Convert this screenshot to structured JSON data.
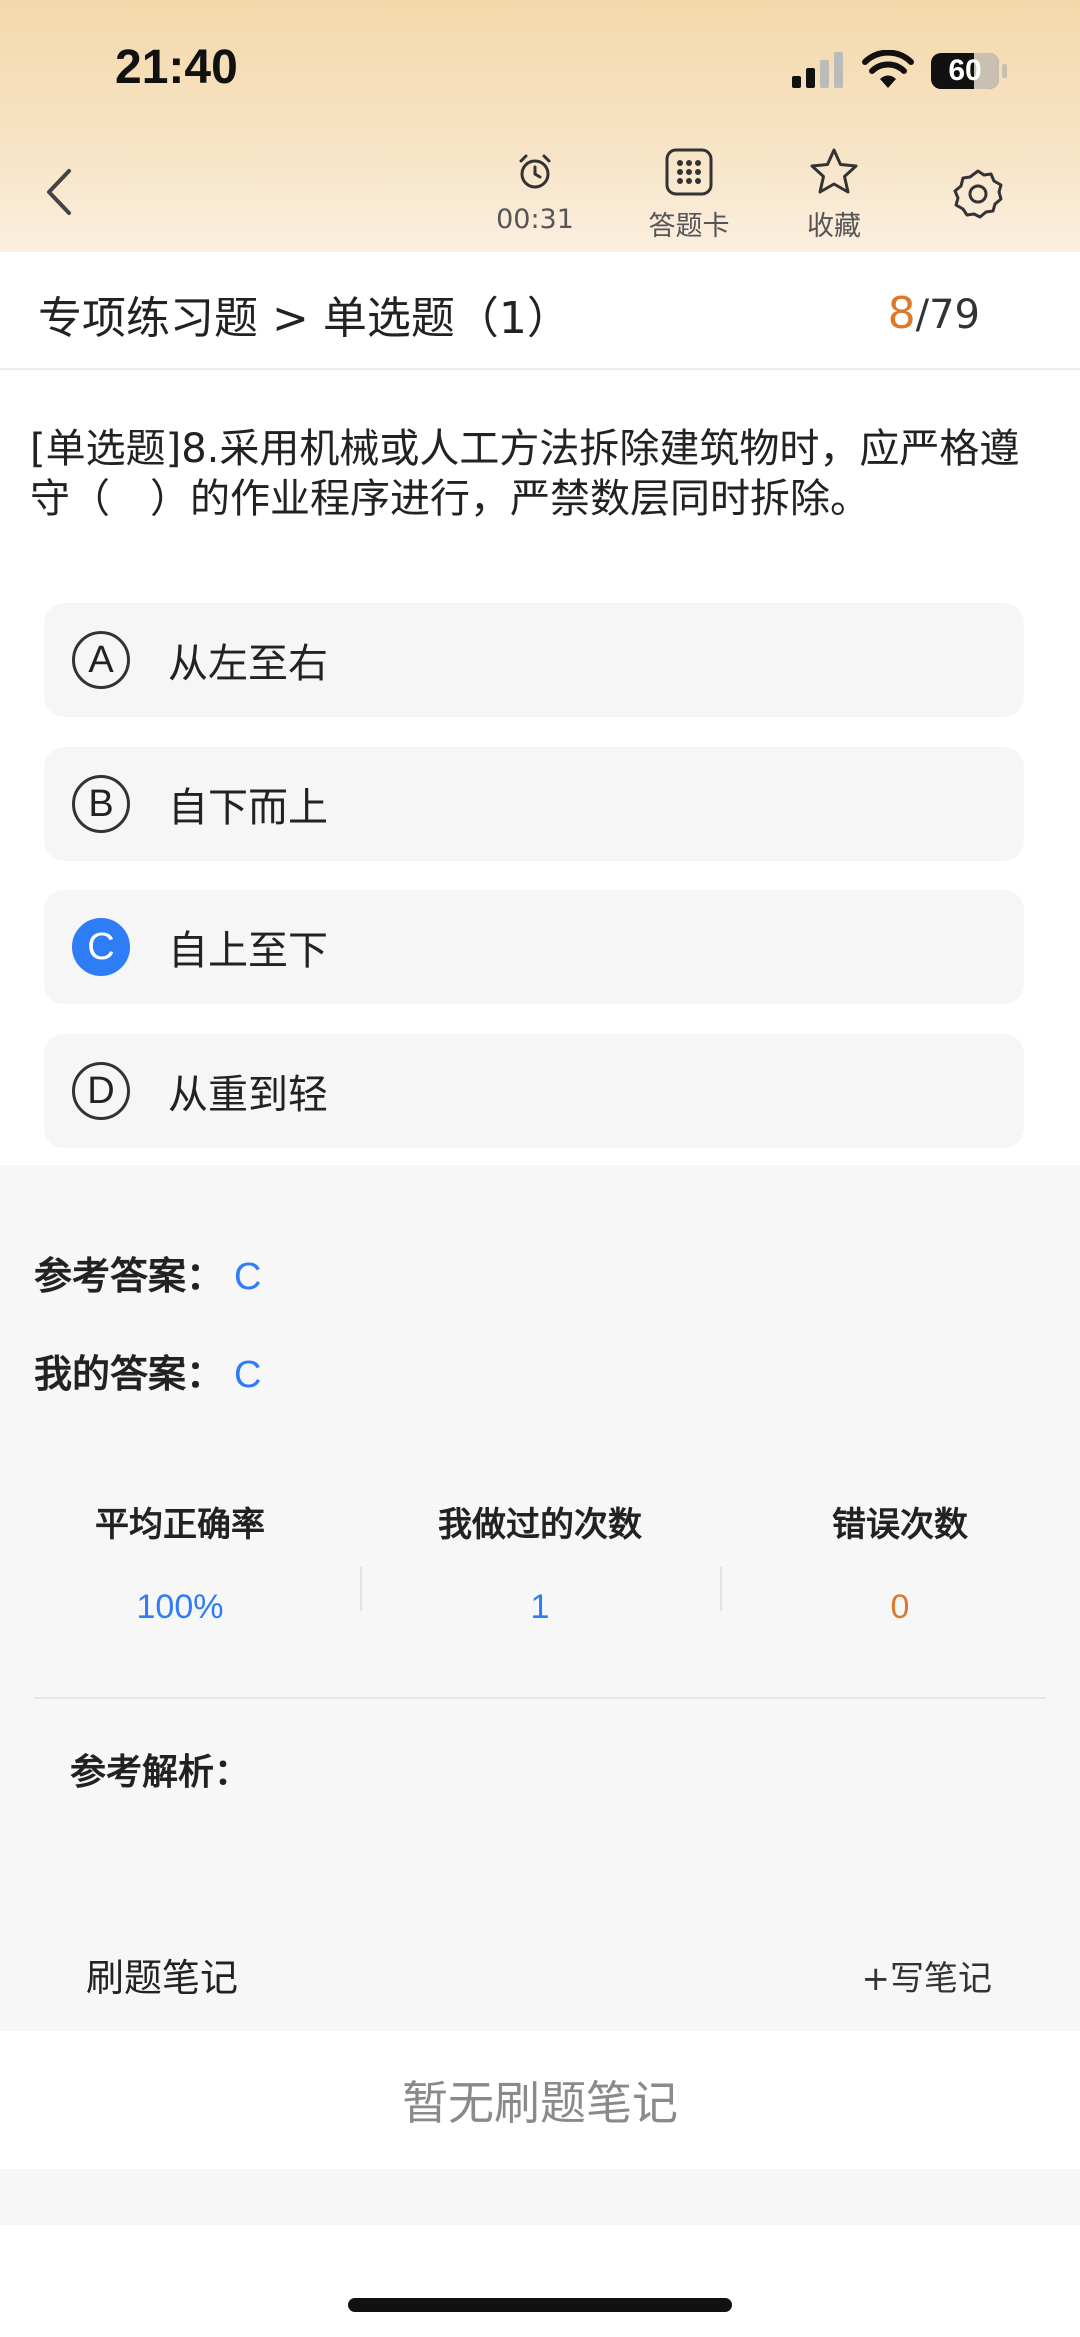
{
  "status_bar": {
    "time": "21:40",
    "battery": "60"
  },
  "nav": {
    "timer": "00:31",
    "answer_card": "答题卡",
    "favorite": "收藏"
  },
  "section": {
    "breadcrumb": "专项练习题 > 单选题（1）",
    "current": "8",
    "total": "/79"
  },
  "question": {
    "text": "[单选题]8.采用机械或人工方法拆除建筑物时，应严格遵守（　）的作业程序进行，严禁数层同时拆除。",
    "options": [
      {
        "letter": "A",
        "text": "从左至右"
      },
      {
        "letter": "B",
        "text": "自下而上"
      },
      {
        "letter": "C",
        "text": "自上至下"
      },
      {
        "letter": "D",
        "text": "从重到轻"
      }
    ],
    "selected": "C"
  },
  "answer": {
    "reference_label": "参考答案：",
    "reference_value": "C",
    "mine_label": "我的答案：",
    "mine_value": "C"
  },
  "stats": [
    {
      "name": "平均正确率",
      "value": "100%",
      "color": "#2f7df6"
    },
    {
      "name": "我做过的次数",
      "value": "1",
      "color": "#2f7df6"
    },
    {
      "name": "错误次数",
      "value": "0",
      "color": "#e0782a"
    }
  ],
  "analysis": {
    "label": "参考解析："
  },
  "notes": {
    "label": "刷题笔记",
    "add": "+写笔记",
    "empty": "暂无刷题笔记"
  }
}
